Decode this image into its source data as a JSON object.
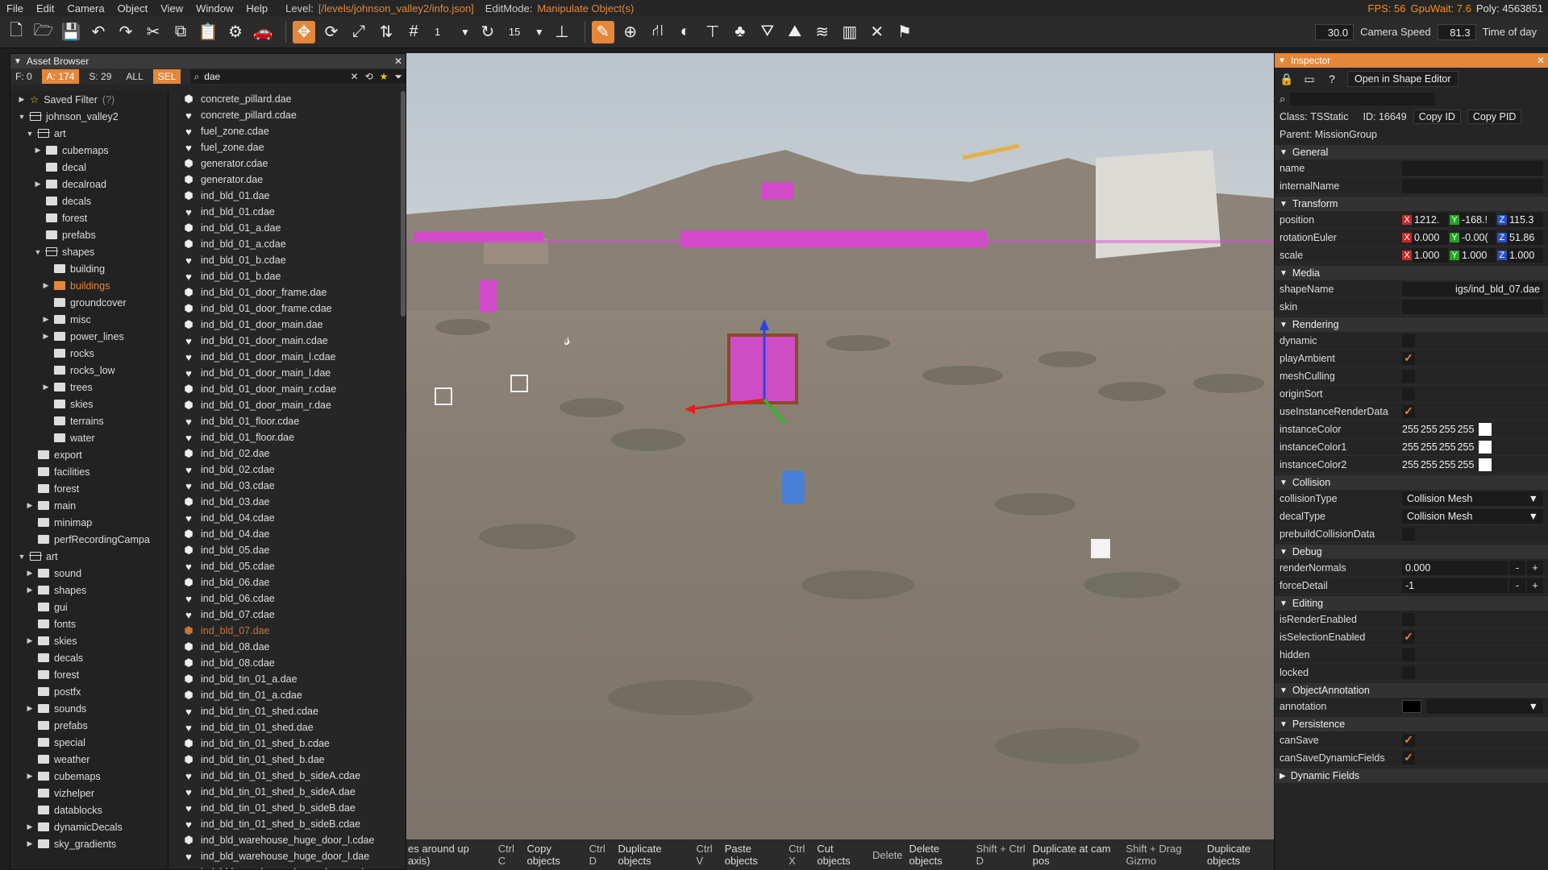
{
  "menubar": {
    "items": [
      "File",
      "Edit",
      "Camera",
      "Object",
      "View",
      "Window",
      "Help"
    ],
    "level_label": "Level:",
    "level_value": "[/levels/johnson_valley2/info.json]",
    "editmode_label": "EditMode:",
    "editmode_value": "Manipulate Object(s)",
    "fps": "FPS: 56",
    "gpuwait": "GpuWait: 7.6",
    "poly": "Poly: 4563851"
  },
  "toolbar": {
    "grid_size": "1",
    "rotate_snap": "15",
    "camera_value": "30.0",
    "camera_speed_label": "Camera Speed",
    "camera_speed_value": "81.3",
    "time_of_day_label": "Time of day"
  },
  "asset_browser": {
    "title": "Asset Browser",
    "counts": {
      "f": "F: 0",
      "a": "A: 174",
      "s": "S: 29"
    },
    "filter_all": "ALL",
    "filter_sel": "SEL",
    "search_query": "dae",
    "tree": [
      {
        "label": "Saved Filter",
        "suffix": "(?)"
      },
      {
        "label": "johnson_valley2"
      },
      {
        "label": "art"
      },
      {
        "label": "cubemaps"
      },
      {
        "label": "decal"
      },
      {
        "label": "decalroad"
      },
      {
        "label": "decals"
      },
      {
        "label": "forest"
      },
      {
        "label": "prefabs"
      },
      {
        "label": "shapes"
      },
      {
        "label": "building"
      },
      {
        "label": "buildings"
      },
      {
        "label": "groundcover"
      },
      {
        "label": "misc"
      },
      {
        "label": "power_lines"
      },
      {
        "label": "rocks"
      },
      {
        "label": "rocks_low"
      },
      {
        "label": "trees"
      },
      {
        "label": "skies"
      },
      {
        "label": "terrains"
      },
      {
        "label": "water"
      },
      {
        "label": "export"
      },
      {
        "label": "facilities"
      },
      {
        "label": "forest"
      },
      {
        "label": "main"
      },
      {
        "label": "minimap"
      },
      {
        "label": "perfRecordingCampa"
      },
      {
        "label": "art"
      },
      {
        "label": "sound"
      },
      {
        "label": "shapes"
      },
      {
        "label": "gui"
      },
      {
        "label": "fonts"
      },
      {
        "label": "skies"
      },
      {
        "label": "decals"
      },
      {
        "label": "forest"
      },
      {
        "label": "postfx"
      },
      {
        "label": "sounds"
      },
      {
        "label": "prefabs"
      },
      {
        "label": "special"
      },
      {
        "label": "weather"
      },
      {
        "label": "cubemaps"
      },
      {
        "label": "vizhelper"
      },
      {
        "label": "datablocks"
      },
      {
        "label": "dynamicDecals"
      },
      {
        "label": "sky_gradients"
      }
    ],
    "files": [
      {
        "name": "concrete_pillard.dae",
        "icon": "box"
      },
      {
        "name": "concrete_pillard.cdae",
        "icon": "heart"
      },
      {
        "name": "fuel_zone.cdae",
        "icon": "heart"
      },
      {
        "name": "fuel_zone.dae",
        "icon": "heart"
      },
      {
        "name": "generator.cdae",
        "icon": "box"
      },
      {
        "name": "generator.dae",
        "icon": "box"
      },
      {
        "name": "ind_bld_01.dae",
        "icon": "box"
      },
      {
        "name": "ind_bld_01.cdae",
        "icon": "heart"
      },
      {
        "name": "ind_bld_01_a.dae",
        "icon": "box"
      },
      {
        "name": "ind_bld_01_a.cdae",
        "icon": "box"
      },
      {
        "name": "ind_bld_01_b.cdae",
        "icon": "heart"
      },
      {
        "name": "ind_bld_01_b.dae",
        "icon": "heart"
      },
      {
        "name": "ind_bld_01_door_frame.dae",
        "icon": "box"
      },
      {
        "name": "ind_bld_01_door_frame.cdae",
        "icon": "box"
      },
      {
        "name": "ind_bld_01_door_main.dae",
        "icon": "box"
      },
      {
        "name": "ind_bld_01_door_main.cdae",
        "icon": "heart"
      },
      {
        "name": "ind_bld_01_door_main_l.cdae",
        "icon": "heart"
      },
      {
        "name": "ind_bld_01_door_main_l.dae",
        "icon": "heart"
      },
      {
        "name": "ind_bld_01_door_main_r.cdae",
        "icon": "box"
      },
      {
        "name": "ind_bld_01_door_main_r.dae",
        "icon": "box"
      },
      {
        "name": "ind_bld_01_floor.cdae",
        "icon": "heart"
      },
      {
        "name": "ind_bld_01_floor.dae",
        "icon": "heart"
      },
      {
        "name": "ind_bld_02.dae",
        "icon": "box"
      },
      {
        "name": "ind_bld_02.cdae",
        "icon": "heart"
      },
      {
        "name": "ind_bld_03.cdae",
        "icon": "heart"
      },
      {
        "name": "ind_bld_03.dae",
        "icon": "box"
      },
      {
        "name": "ind_bld_04.cdae",
        "icon": "heart"
      },
      {
        "name": "ind_bld_04.dae",
        "icon": "box"
      },
      {
        "name": "ind_bld_05.dae",
        "icon": "box"
      },
      {
        "name": "ind_bld_05.cdae",
        "icon": "heart"
      },
      {
        "name": "ind_bld_06.dae",
        "icon": "box"
      },
      {
        "name": "ind_bld_06.cdae",
        "icon": "heart"
      },
      {
        "name": "ind_bld_07.cdae",
        "icon": "heart"
      },
      {
        "name": "ind_bld_07.dae",
        "icon": "box",
        "selected": true
      },
      {
        "name": "ind_bld_08.dae",
        "icon": "box"
      },
      {
        "name": "ind_bld_08.cdae",
        "icon": "box"
      },
      {
        "name": "ind_bld_tin_01_a.dae",
        "icon": "box"
      },
      {
        "name": "ind_bld_tin_01_a.cdae",
        "icon": "box"
      },
      {
        "name": "ind_bld_tin_01_shed.cdae",
        "icon": "heart"
      },
      {
        "name": "ind_bld_tin_01_shed.dae",
        "icon": "heart"
      },
      {
        "name": "ind_bld_tin_01_shed_b.cdae",
        "icon": "box"
      },
      {
        "name": "ind_bld_tin_01_shed_b.dae",
        "icon": "box"
      },
      {
        "name": "ind_bld_tin_01_shed_b_sideA.cdae",
        "icon": "heart"
      },
      {
        "name": "ind_bld_tin_01_shed_b_sideA.dae",
        "icon": "heart"
      },
      {
        "name": "ind_bld_tin_01_shed_b_sideB.dae",
        "icon": "heart"
      },
      {
        "name": "ind_bld_tin_01_shed_b_sideB.cdae",
        "icon": "heart"
      },
      {
        "name": "ind_bld_warehouse_huge_door_l.cdae",
        "icon": "box"
      },
      {
        "name": "ind_bld_warehouse_huge_door_l.dae",
        "icon": "heart"
      },
      {
        "name": "ind_bld_warehouse_huge_door_r.cdae",
        "icon": "heart"
      }
    ]
  },
  "statusbar": {
    "hint": "es around up axis)",
    "shortcuts": [
      {
        "key": "Ctrl C",
        "action": "Copy objects"
      },
      {
        "key": "Ctrl D",
        "action": "Duplicate objects"
      },
      {
        "key": "Ctrl V",
        "action": "Paste objects"
      },
      {
        "key": "Ctrl X",
        "action": "Cut objects"
      },
      {
        "key": "Delete",
        "action": "Delete objects"
      },
      {
        "key": "Shift + Ctrl D",
        "action": "Duplicate at cam pos"
      },
      {
        "key": "Shift + Drag Gizmo",
        "action": "Duplicate objects"
      }
    ]
  },
  "inspector": {
    "title": "Inspector",
    "open_shape_editor": "Open in Shape Editor",
    "class_label": "Class:",
    "class_value": "TSStatic",
    "id_label": "ID:",
    "id_value": "16649",
    "copy_id": "Copy ID",
    "copy_pid": "Copy PID",
    "parent_label": "Parent:",
    "parent_value": "MissionGroup",
    "sections": {
      "general": "General",
      "transform": "Transform",
      "media": "Media",
      "rendering": "Rendering",
      "collision": "Collision",
      "debug": "Debug",
      "editing": "Editing",
      "objectannotation": "ObjectAnnotation",
      "persistence": "Persistence",
      "dynamicfields": "Dynamic Fields"
    },
    "general": {
      "name_label": "name",
      "internalname_label": "internalName"
    },
    "transform": {
      "position_label": "position",
      "position": [
        "1212.",
        "-168.!",
        "115.3"
      ],
      "rotation_label": "rotationEuler",
      "rotation": [
        "0.000",
        "-0.00(",
        "51.86"
      ],
      "scale_label": "scale",
      "scale": [
        "1.000",
        "1.000",
        "1.000"
      ]
    },
    "media": {
      "shapename_label": "shapeName",
      "shapename_value": "igs/ind_bld_07.dae",
      "skin_label": "skin"
    },
    "rendering": {
      "dynamic": "dynamic",
      "playambient": "playAmbient",
      "meshculling": "meshCulling",
      "originsort": "originSort",
      "useinstance": "useInstanceRenderData",
      "ic0": "instanceColor",
      "ic1": "instanceColor1",
      "ic2": "instanceColor2",
      "rgba": [
        "255",
        "255",
        "255",
        "255"
      ]
    },
    "collision": {
      "collisiontype_label": "collisionType",
      "collisiontype_value": "Collision Mesh",
      "decaltype_label": "decalType",
      "decaltype_value": "Collision Mesh",
      "prebuild_label": "prebuildCollisionData"
    },
    "debug": {
      "rendernormals_label": "renderNormals",
      "rendernormals_value": "0.000",
      "forcedetail_label": "forceDetail",
      "forcedetail_value": "-1",
      "minus": "-",
      "plus": "+"
    },
    "editing": {
      "isrender": "isRenderEnabled",
      "isselection": "isSelectionEnabled",
      "hidden": "hidden",
      "locked": "locked"
    },
    "annotation_label": "annotation",
    "persistence": {
      "cansave": "canSave",
      "cansavedyn": "canSaveDynamicFields"
    }
  }
}
